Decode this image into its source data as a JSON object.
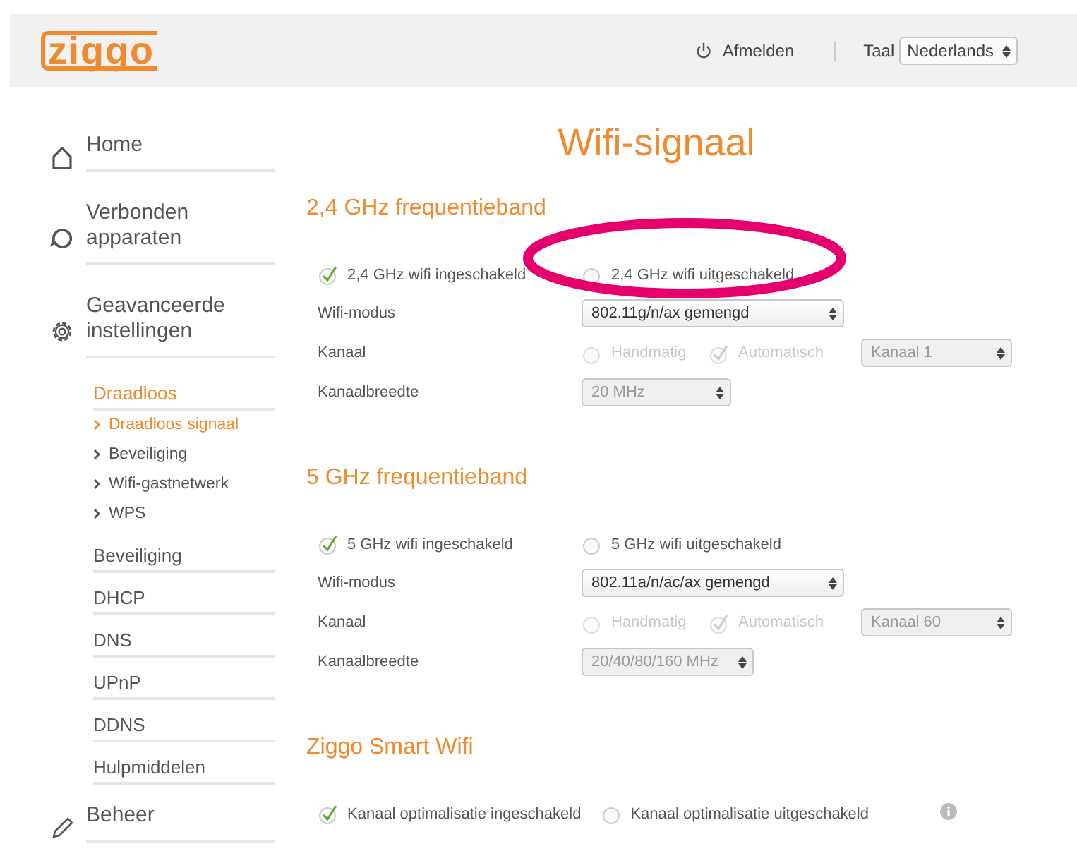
{
  "header": {
    "logo": "ziggo",
    "logout": "Afmelden",
    "language_label": "Taal",
    "language": "Nederlands"
  },
  "sidebar": {
    "items": [
      {
        "label": "Home"
      },
      {
        "label": "Verbonden apparaten"
      },
      {
        "label": "Geavanceerde instellingen",
        "children": [
          {
            "label": "Draadloos",
            "selected": true,
            "children": [
              {
                "label": "Draadloos signaal",
                "selected": true
              },
              {
                "label": "Beveiliging",
                "selected": false
              },
              {
                "label": "Wifi-gastnetwerk",
                "selected": false
              },
              {
                "label": "WPS",
                "selected": false
              }
            ]
          },
          {
            "label": "Beveiliging",
            "selected": false
          },
          {
            "label": "DHCP",
            "selected": false
          },
          {
            "label": "DNS",
            "selected": false
          },
          {
            "label": "UPnP",
            "selected": false
          },
          {
            "label": "DDNS",
            "selected": false
          },
          {
            "label": "Hulpmiddelen",
            "selected": false
          }
        ]
      },
      {
        "label": "Beheer"
      }
    ]
  },
  "page_title": "Wifi-signaal",
  "sections": [
    {
      "title": "2,4 GHz frequentieband",
      "toggles": [
        {
          "label": "2,4 GHz wifi ingeschakeld",
          "selected": true
        },
        {
          "label": "2,4 GHz wifi uitgeschakeld",
          "selected": false
        }
      ],
      "highlight": true,
      "rows": [
        {
          "kind": "select",
          "label": "Wifi-modus",
          "value": "802.11g/n/ax gemengd",
          "disabled": false
        },
        {
          "kind": "channel",
          "label": "Kanaal",
          "options": [
            {
              "label": "Handmatig",
              "selected": false
            },
            {
              "label": "Automatisch",
              "selected": true
            }
          ],
          "value": "Kanaal 1",
          "disabled": true
        },
        {
          "kind": "select",
          "label": "Kanaalbreedte",
          "value": "20 MHz",
          "disabled": true
        }
      ]
    },
    {
      "title": "5 GHz frequentieband",
      "toggles": [
        {
          "label": "5 GHz wifi ingeschakeld",
          "selected": true
        },
        {
          "label": "5 GHz wifi uitgeschakeld",
          "selected": false
        }
      ],
      "rows": [
        {
          "kind": "select",
          "label": "Wifi-modus",
          "value": "802.11a/n/ac/ax gemengd",
          "disabled": false
        },
        {
          "kind": "channel",
          "label": "Kanaal",
          "options": [
            {
              "label": "Handmatig",
              "selected": false
            },
            {
              "label": "Automatisch",
              "selected": true
            }
          ],
          "value": "Kanaal 60",
          "disabled": true
        },
        {
          "kind": "select",
          "label": "Kanaalbreedte",
          "value": "20/40/80/160 MHz",
          "disabled": true
        }
      ]
    },
    {
      "title": "Ziggo Smart Wifi",
      "toggles": [
        {
          "label": "Kanaal optimalisatie ingeschakeld",
          "selected": true
        },
        {
          "label": "Kanaal optimalisatie uitgeschakeld",
          "selected": false
        }
      ],
      "info": true
    }
  ]
}
